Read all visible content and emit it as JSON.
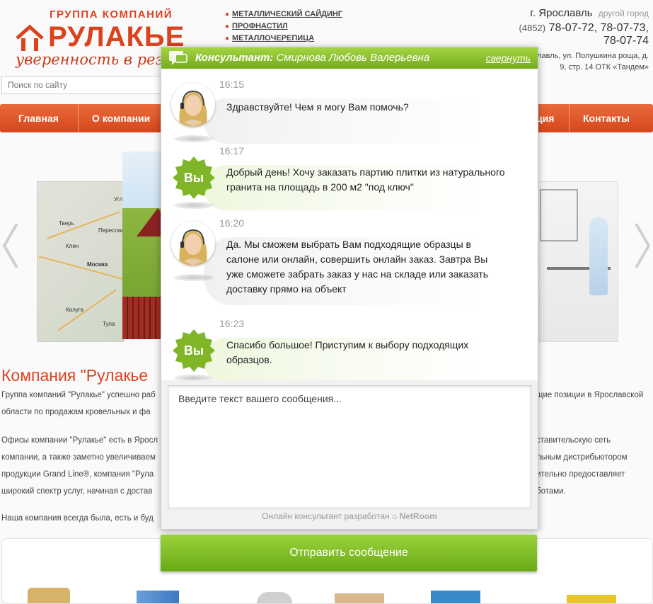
{
  "header": {
    "group_label": "ГРУППА КОМПАНИЙ",
    "brand_name": "РУЛАКЬЕ",
    "slogan": "уверенность в результате",
    "top_links": [
      "МЕТАЛЛИЧЕСКИЙ САЙДИНГ",
      "ПРОФНАСТИЛ",
      "МЕТАЛЛОЧЕРЕПИЦА"
    ],
    "city": "г. Ярославль",
    "other_city": "другой город",
    "phone_code": "(4852)",
    "phones_line1": "78-07-72, 78-07-73,",
    "phones_line2": "78-07-74",
    "address_line1": "лавль, ул. Полушкина роща, д.",
    "address_line2": "9, стр. 14 ОТК «Тандем»"
  },
  "search": {
    "placeholder": "Поиск по сайту"
  },
  "nav": {
    "items": [
      "Главная",
      "О компании",
      "ция",
      "Контакты"
    ]
  },
  "slider": {
    "map_labels": [
      "Тверь",
      "Переслав",
      "Углич",
      "Клин",
      "Москва",
      "Калуга",
      "Тула"
    ]
  },
  "content": {
    "title": "Компания \"Рулакье",
    "left_lines": [
      "Группа компаний \"Рулакье\" успешно раб",
      "области по продажам  кровельных и фа",
      "Офисы компании \"Рулакье\" есть в Яросл",
      "компании, а также заметно увеличиваем",
      "продукции Grand Line®, компания \"Рула",
      "широкий спектр услуг, начиная с достав",
      "Наша компания всегда была, есть и буд"
    ],
    "right_lines": [
      "щие позиции в Ярославской",
      "ставительскую сеть",
      "льным дистрибьютором",
      "ительно предоставляет",
      "ботами."
    ]
  },
  "chat": {
    "title_label": "Консультант:",
    "consultant_name": "Смирнова Любовь Валерьевна",
    "collapse_label": "свернуть",
    "you_label": "Вы",
    "messages": [
      {
        "from": "operator",
        "time": "16:15",
        "text": "Здравствуйте! Чем я могу Вам помочь?"
      },
      {
        "from": "user",
        "time": "16:17",
        "text": "Добрый день! Хочу заказать партию плитки из натурального гранита на площадь в 200 м2 \"под ключ\""
      },
      {
        "from": "operator",
        "time": "16:20",
        "text": "Да. Мы сможем выбрать Вам подходящие образцы в салоне или онлайн, совершить онлайн заказ. Завтра Вы уже сможете забрать заказ у нас на складе или заказать доставку прямо на объект"
      },
      {
        "from": "user",
        "time": "16:23",
        "text": "Спасибо большое! Приступим к выбору подходящих образцов."
      }
    ],
    "input_placeholder": "Введите текст вашего сообщения...",
    "credits_text": "Онлайн консультант разработан",
    "credits_brand": "NetRoom",
    "send_label": "Отправить сообщение"
  },
  "colors": {
    "brand_red": "#d9431e",
    "chat_green": "#7fb526"
  }
}
